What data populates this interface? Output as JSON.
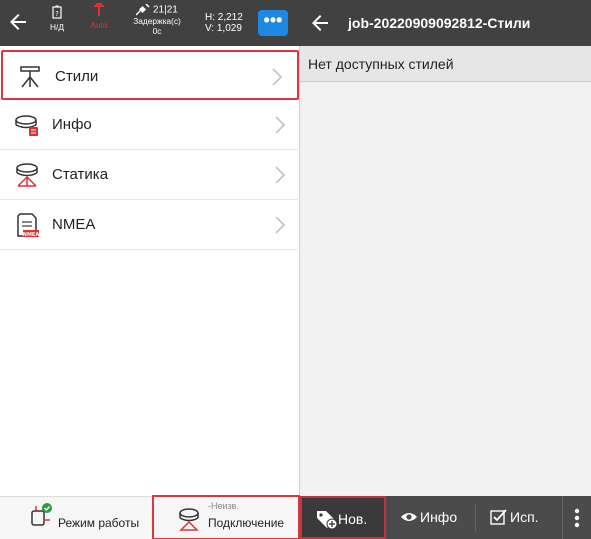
{
  "left_panel": {
    "status": {
      "slot1_label": "Н/Д",
      "slot2_label": "Auto",
      "satellites": "21|21",
      "delay_label": "Задержка(с)",
      "delay_value": "0с",
      "h_value": "H: 2,212",
      "v_value": "V: 1,029"
    },
    "menu": {
      "items": [
        {
          "label": "Стили",
          "icon": "style-icon"
        },
        {
          "label": "Инфо",
          "icon": "info-receiver-icon"
        },
        {
          "label": "Статика",
          "icon": "static-icon"
        },
        {
          "label": "NMEA",
          "icon": "nmea-icon"
        }
      ]
    },
    "bottom": {
      "mode_label": "Режим работы",
      "connection_label": "Подключение",
      "connection_status": "-Неизв."
    }
  },
  "right_panel": {
    "title": "job-20220909092812-Стили",
    "empty_message": "Нет доступных стилей",
    "toolbar": {
      "new_label": "Нов.",
      "info_label": "Инфо",
      "use_label": "Исп."
    }
  },
  "colors": {
    "header_bg": "#414141",
    "accent_blue": "#1e88e5",
    "highlight_red": "#d9363e",
    "icon_red": "#e03030"
  }
}
